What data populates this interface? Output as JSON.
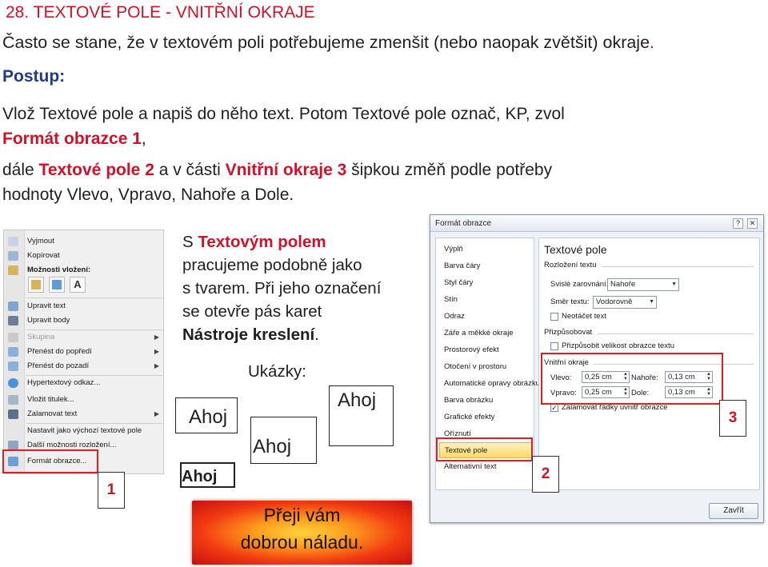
{
  "title": "28.  TEXTOVÉ POLE - VNITŘNÍ OKRAJE",
  "intro": {
    "text": "Často se stane, že v textovém poli potřebujeme zmenšit (nebo naopak zvětšit) okraje",
    "dot": "."
  },
  "postup": "Postup:",
  "step1": {
    "line1": "Vlož Textové pole a napiš do něho text. Potom Textové pole označ, KP, zvol",
    "line2_red": "Formát obrazce 1",
    "line2_rest": ","
  },
  "step2": {
    "a": "dále ",
    "b_red": "Textové pole 2",
    "c": " a v části ",
    "d_red": "Vnitřní okraje 3",
    "e": " šipkou změň podle potřeby",
    "line2": "hodnoty Vlevo, Vpravo, Nahoře a Dole."
  },
  "context_menu": {
    "items": [
      {
        "label": "Vyjmout",
        "icon": "scissors-icon"
      },
      {
        "label": "Kopírovat",
        "icon": "copy-icon"
      },
      {
        "label": "Možnosti vložení:",
        "icon": "paste-icon"
      },
      {
        "label": "Upravit text",
        "icon": "edit-text-icon"
      },
      {
        "label": "Upravit body",
        "icon": "edit-points-icon"
      },
      {
        "label": "Skupina",
        "icon": "group-icon"
      },
      {
        "label": "Přenést do popředí",
        "icon": "bring-forward-icon"
      },
      {
        "label": "Přenést do pozadí",
        "icon": "send-backward-icon"
      },
      {
        "label": "Hypertextový odkaz...",
        "icon": "hyperlink-icon"
      },
      {
        "label": "Vložit titulek...",
        "icon": "caption-icon"
      },
      {
        "label": "Zalamovat text",
        "icon": "wrap-text-icon"
      },
      {
        "label": "Nastavit jako výchozí textové pole",
        "icon": ""
      },
      {
        "label": "Další možnosti rozložení...",
        "icon": "layout-icon"
      },
      {
        "label": "Formát obrazce...",
        "icon": "format-shape-icon"
      }
    ]
  },
  "markers": {
    "one": "1",
    "two": "2",
    "three": "3"
  },
  "middle": {
    "l1a": "S ",
    "l1b_red": "Textovým polem",
    "l2": "pracujeme podobně jako",
    "l3": "s tvarem. Při jeho označení",
    "l4": "se otevře pás karet",
    "l5_bold": "Nástroje kreslení",
    "l5_end": "."
  },
  "examples": {
    "heading": "Ukázky:",
    "box1": "Ahoj",
    "box2": "Ahoj",
    "box3": "Ahoj",
    "box4": "Ahoj"
  },
  "banner": {
    "line1": "Přeji vám",
    "line2": "dobrou náladu."
  },
  "dialog": {
    "title": "Formát obrazce",
    "left_items": [
      "Výplň",
      "Barva čáry",
      "Styl čáry",
      "Stín",
      "Odraz",
      "Záře a měkké okraje",
      "Prostorový efekt",
      "Otočení v prostoru",
      "Automatické opravy obrázku",
      "Barva obrázku",
      "Grafické efekty",
      "Oříznutí",
      "Textové pole",
      "Alternativní text"
    ],
    "selected_index": 12,
    "section_title": "Textové pole",
    "layout_heading": "Rozložení textu",
    "vertical_label": "Svislé zarovnání:",
    "vertical_value": "Nahoře",
    "direction_label": "Směr textu:",
    "direction_value": "Vodorovně",
    "no_rotate": "Neotáčet text",
    "autofit_heading": "Přizpůsobovat",
    "autofit_label": "Přizpůsobit velikost obrazce textu",
    "margins_heading": "Vnitřní okraje",
    "left_label": "Vlevo:",
    "left_value": "0,25 cm",
    "top_label": "Nahoře:",
    "top_value": "0,13 cm",
    "right_label": "Vpravo:",
    "right_value": "0,25 cm",
    "bottom_label": "Dole:",
    "bottom_value": "0,13 cm",
    "wrap_label": "Zalamovat řádky uvnitř obrazce",
    "close_label": "Zavřít"
  }
}
